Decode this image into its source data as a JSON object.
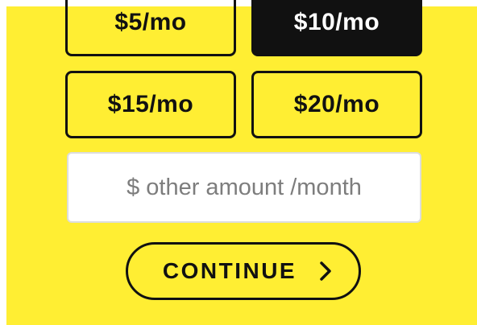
{
  "amount_options": [
    {
      "label": "$5/mo",
      "selected": false
    },
    {
      "label": "$10/mo",
      "selected": true
    },
    {
      "label": "$15/mo",
      "selected": false
    },
    {
      "label": "$20/mo",
      "selected": false
    }
  ],
  "other_amount": {
    "value": "",
    "placeholder": "$ other amount /month"
  },
  "continue_button": {
    "label": "CONTINUE",
    "icon": "chevron-right-icon"
  },
  "colors": {
    "background": "#ffee33",
    "ink": "#111111",
    "selected_text": "#ffffff",
    "input_background": "#ffffff",
    "placeholder": "#7d7d7d"
  }
}
